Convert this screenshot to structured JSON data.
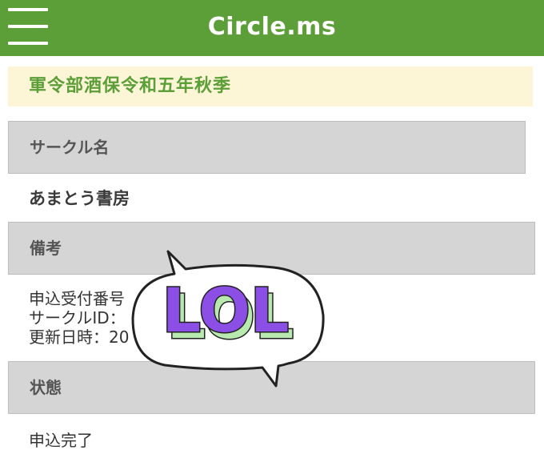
{
  "header": {
    "brand": "Circle.ms",
    "menu_icon": "hamburger-menu-icon",
    "background": "#5c9e38"
  },
  "event": {
    "title": "軍令部酒保令和五年秋季",
    "background": "#fcf5d6",
    "color": "#5c9e38"
  },
  "sections": {
    "circle_name": {
      "label": "サークル名",
      "value": "あまとう書房"
    },
    "remarks": {
      "label": "備考",
      "lines": [
        "申込受付番号",
        "サークルID：",
        "更新日時：20"
      ]
    },
    "status": {
      "label": "状態",
      "value": "申込完了"
    }
  },
  "sticker": {
    "text": "LOL",
    "fill": "#8b4fe6",
    "shadow": "#b8eab0",
    "icon": "speech-bubble-icon"
  }
}
